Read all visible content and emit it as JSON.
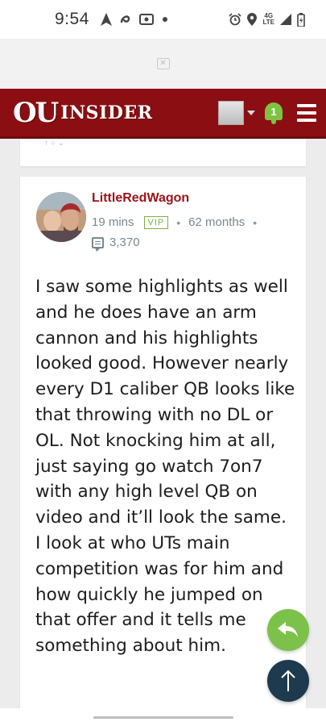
{
  "status_bar": {
    "time": "9:54",
    "left_icons": [
      "navigation-icon",
      "app-icon",
      "cast-icon",
      "dot-icon"
    ],
    "right_icons": [
      "alarm-icon",
      "location-icon",
      "lte-signal-icon",
      "battery-icon"
    ],
    "network": "4G LTE"
  },
  "header": {
    "logo_ou": "OU",
    "logo_insider": "INSIDER",
    "notification_count": "1",
    "colors": {
      "background": "#8b0e12",
      "notification": "#7dc242"
    }
  },
  "post": {
    "username": "LittleRedWagon",
    "time_ago": "19 mins",
    "badge": "VIP",
    "membership": "62 months",
    "post_count": "3,370",
    "body": "I saw some highlights as well and he does have an arm cannon and his highlights looked good. However nearly every D1 caliber QB looks like that throwing with no DL or OL. Not knocking him at all, just saying go watch 7on7 with any high level QB on video and it’ll look the same. I look at who UTs main competition was for him and how quickly he jumped on that offer and it tells me something about him."
  },
  "fabs": {
    "reply_color": "#7cc14a",
    "top_color": "#1d3a4f"
  }
}
